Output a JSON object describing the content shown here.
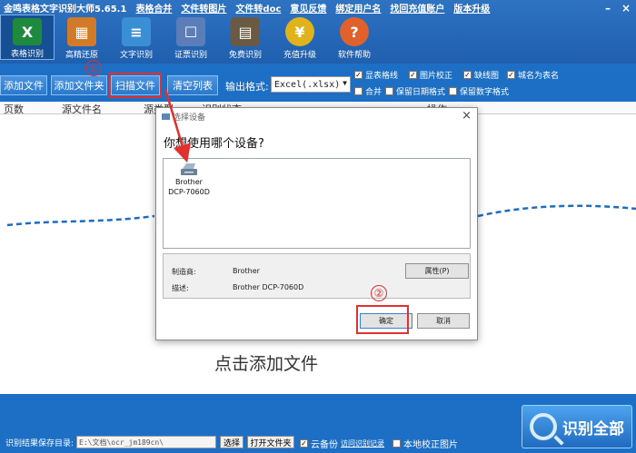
{
  "app": {
    "title": "金鸣表格文字识别大师5.65.1",
    "menu": [
      "表格合并",
      "文件转图片",
      "文件转doc",
      "意见反馈",
      "绑定用户名",
      "找回充值账户",
      "版本升级"
    ]
  },
  "tools": [
    {
      "label": "表格识别",
      "icon": "excel-icon",
      "color": "#1f8a3e",
      "glyph": "X"
    },
    {
      "label": "高精还原",
      "icon": "grid-icon",
      "color": "#d07a2a",
      "glyph": "▦"
    },
    {
      "label": "文字识别",
      "icon": "document-icon",
      "color": "#3a8fd4",
      "glyph": "≡"
    },
    {
      "label": "证票识别",
      "icon": "id-card-icon",
      "color": "#5b7db8",
      "glyph": "☐"
    },
    {
      "label": "免费识别",
      "icon": "book-icon",
      "color": "#6a5a44",
      "glyph": "▤"
    },
    {
      "label": "充值升级",
      "icon": "coin-icon",
      "color": "#e0b21c",
      "glyph": "¥"
    },
    {
      "label": "软件帮助",
      "icon": "help-icon",
      "color": "#e0612b",
      "glyph": "?"
    }
  ],
  "toolbar": {
    "add_file": "添加文件",
    "add_folder": "添加文件夹",
    "scan_file": "扫描文件",
    "clear_list": "清空列表",
    "format_label": "输出格式:",
    "format_value": "Excel(.xlsx)"
  },
  "options": {
    "row1": [
      {
        "label": "显表格线",
        "checked": true
      },
      {
        "label": "图片校正",
        "checked": true
      },
      {
        "label": "缺线图",
        "checked": true
      },
      {
        "label": "城名为表名",
        "checked": true
      }
    ],
    "row2": [
      {
        "label": "合并",
        "checked": false
      },
      {
        "label": "保留日期格式",
        "checked": false
      },
      {
        "label": "保留数字格式",
        "checked": false
      }
    ]
  },
  "table_headers": {
    "pages": "页数",
    "source_name": "源文件名",
    "source_type": "源类型",
    "result": "识别状态",
    "action": "操作"
  },
  "main": {
    "drop_hint": "点击添加文件"
  },
  "bottom": {
    "save_dir_label": "识别结果保存目录:",
    "save_dir_value": "E:\\文档\\ocr_jm189cn\\",
    "choose_btn": "选择",
    "open_folder_btn": "打开文件夹",
    "cloud_backup": "云备份",
    "cloud_link": "访问识别记录",
    "local_fix": "本地校正图片",
    "recognize_all": "识别全部"
  },
  "dialog": {
    "title": "选择设备",
    "question": "你想使用哪个设备?",
    "device_name_1": "Brother",
    "device_name_2": "DCP-7060D",
    "manufacturer_label": "制造商:",
    "manufacturer_value": "Brother",
    "description_label": "描述:",
    "description_value": "Brother DCP-7060D",
    "properties_btn": "属性(P)",
    "ok_btn": "确定",
    "cancel_btn": "取消"
  },
  "annotations": {
    "step1": "①",
    "step2": "②",
    "color": "#e03030"
  }
}
